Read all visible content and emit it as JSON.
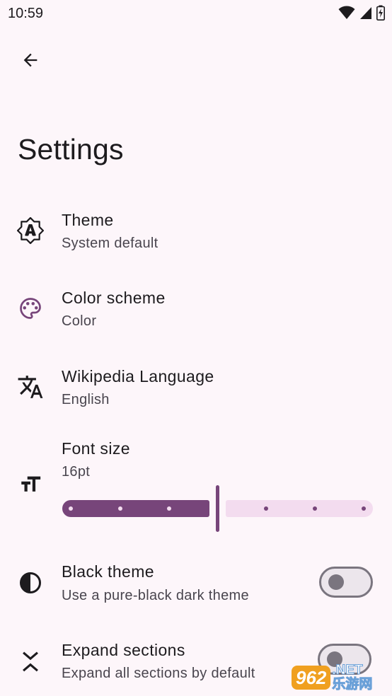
{
  "status_bar": {
    "time": "10:59",
    "icons": [
      "wifi-icon",
      "cellular-signal-icon",
      "battery-charging-icon"
    ]
  },
  "toolbar": {
    "back_icon": "arrow-back-icon"
  },
  "page": {
    "title": "Settings"
  },
  "settings": {
    "theme": {
      "title": "Theme",
      "subtitle": "System default",
      "icon": "brightness-auto-icon"
    },
    "color_scheme": {
      "title": "Color scheme",
      "subtitle": "Color",
      "icon": "palette-icon"
    },
    "language": {
      "title": "Wikipedia Language",
      "subtitle": "English",
      "icon": "translate-icon"
    },
    "font_size": {
      "title": "Font size",
      "subtitle": "16pt",
      "icon": "text-size-icon",
      "slider_value_fraction": 0.5
    },
    "black_theme": {
      "title": "Black theme",
      "subtitle": "Use a pure-black dark theme",
      "icon": "contrast-icon",
      "enabled": false
    },
    "expand_sections": {
      "title": "Expand sections",
      "subtitle": "Expand all sections by default",
      "icon": "unfold-icon",
      "enabled": false
    }
  },
  "watermark": {
    "badge": "962",
    "suffix": ".NET",
    "caption": "乐游网"
  },
  "colors": {
    "accent": "#77457a",
    "background": "#fdf6fa",
    "track_inactive": "#f3dcef"
  }
}
